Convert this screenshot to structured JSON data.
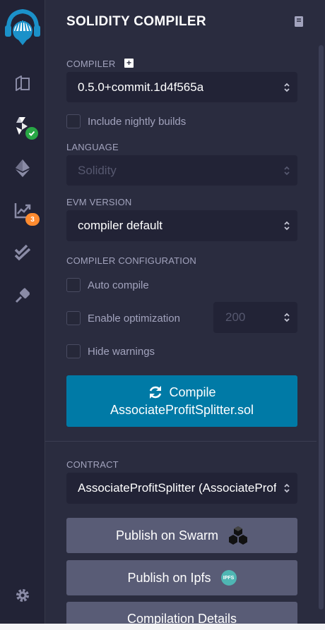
{
  "rail": {
    "logo_icon": "remix-logo-icon",
    "items": [
      {
        "icon": "file-explorer-icon"
      },
      {
        "icon": "solidity-compiler-icon",
        "badge_icon": "check-icon",
        "badge_color": "#28a745"
      },
      {
        "icon": "deploy-run-icon"
      },
      {
        "icon": "analysis-chart-icon",
        "badge": "3",
        "badge_color": "#ff8b30"
      },
      {
        "icon": "double-check-icon"
      },
      {
        "icon": "plugin-icon"
      }
    ],
    "settings_icon": "gear-icon"
  },
  "panel": {
    "title": "SOLIDITY COMPILER",
    "docs_icon": "book-icon",
    "compiler": {
      "label": "COMPILER",
      "add_icon": "plus-square-icon",
      "selected": "0.5.0+commit.1d4f565a"
    },
    "nightly": {
      "label": "Include nightly builds",
      "checked": false
    },
    "language": {
      "label": "LANGUAGE",
      "selected": "Solidity",
      "disabled": true
    },
    "evm": {
      "label": "EVM VERSION",
      "selected": "compiler default"
    },
    "config": {
      "label": "COMPILER CONFIGURATION",
      "auto_compile": "Auto compile",
      "optimization": "Enable optimization",
      "runs": "200",
      "hide_warnings": "Hide warnings"
    },
    "compile_button": {
      "line1": "Compile",
      "line2": "AssociateProfitSplitter.sol",
      "icon": "refresh-icon"
    },
    "contract": {
      "label": "CONTRACT",
      "selected": "AssociateProfitSplitter (AssociateProfitSplitter.sol)"
    },
    "buttons": {
      "swarm": "Publish on Swarm",
      "ipfs": "Publish on Ipfs",
      "ipfs_badge": "IPFS",
      "details": "Compilation Details"
    }
  },
  "colors": {
    "accent": "#007aa6",
    "background": "#2a2c3f",
    "rail": "#222336",
    "button_gray": "#595c76",
    "badge_orange": "#ff8b30",
    "badge_green": "#28a745"
  }
}
